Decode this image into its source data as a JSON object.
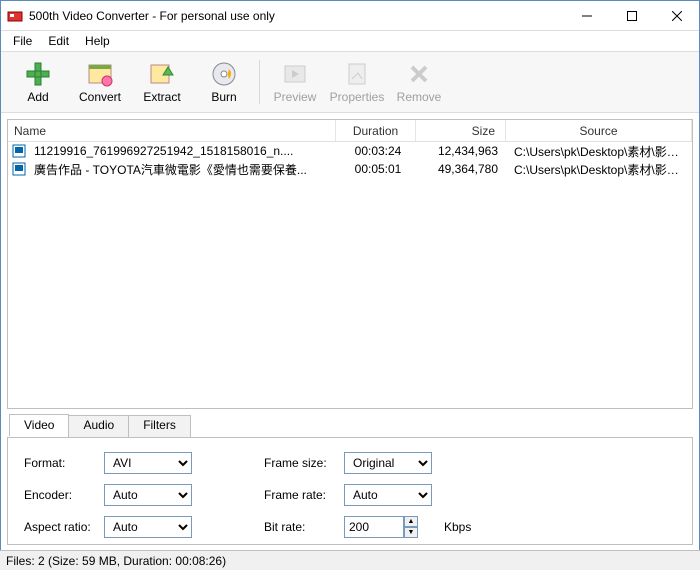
{
  "window": {
    "title": "500th Video Converter - For personal use only"
  },
  "menu": {
    "file": "File",
    "edit": "Edit",
    "help": "Help"
  },
  "toolbar": {
    "add": "Add",
    "convert": "Convert",
    "extract": "Extract",
    "burn": "Burn",
    "preview": "Preview",
    "properties": "Properties",
    "remove": "Remove"
  },
  "list": {
    "headers": {
      "name": "Name",
      "duration": "Duration",
      "size": "Size",
      "source": "Source"
    },
    "rows": [
      {
        "name": "11219916_761996927251942_1518158016_n....",
        "duration": "00:03:24",
        "size": "12,434,963",
        "source": "C:\\Users\\pk\\Desktop\\素材\\影片..."
      },
      {
        "name": "廣告作品 - TOYOTA汽車微電影《愛情也需要保養...",
        "duration": "00:05:01",
        "size": "49,364,780",
        "source": "C:\\Users\\pk\\Desktop\\素材\\影片..."
      }
    ]
  },
  "tabs": {
    "video": "Video",
    "audio": "Audio",
    "filters": "Filters"
  },
  "video_settings": {
    "format_label": "Format:",
    "format_value": "AVI",
    "encoder_label": "Encoder:",
    "encoder_value": "Auto",
    "aspect_label": "Aspect ratio:",
    "aspect_value": "Auto",
    "framesize_label": "Frame size:",
    "framesize_value": "Original",
    "framerate_label": "Frame rate:",
    "framerate_value": "Auto",
    "bitrate_label": "Bit rate:",
    "bitrate_value": "200",
    "bitrate_unit": "Kbps"
  },
  "status": "Files: 2 (Size: 59 MB, Duration: 00:08:26)"
}
